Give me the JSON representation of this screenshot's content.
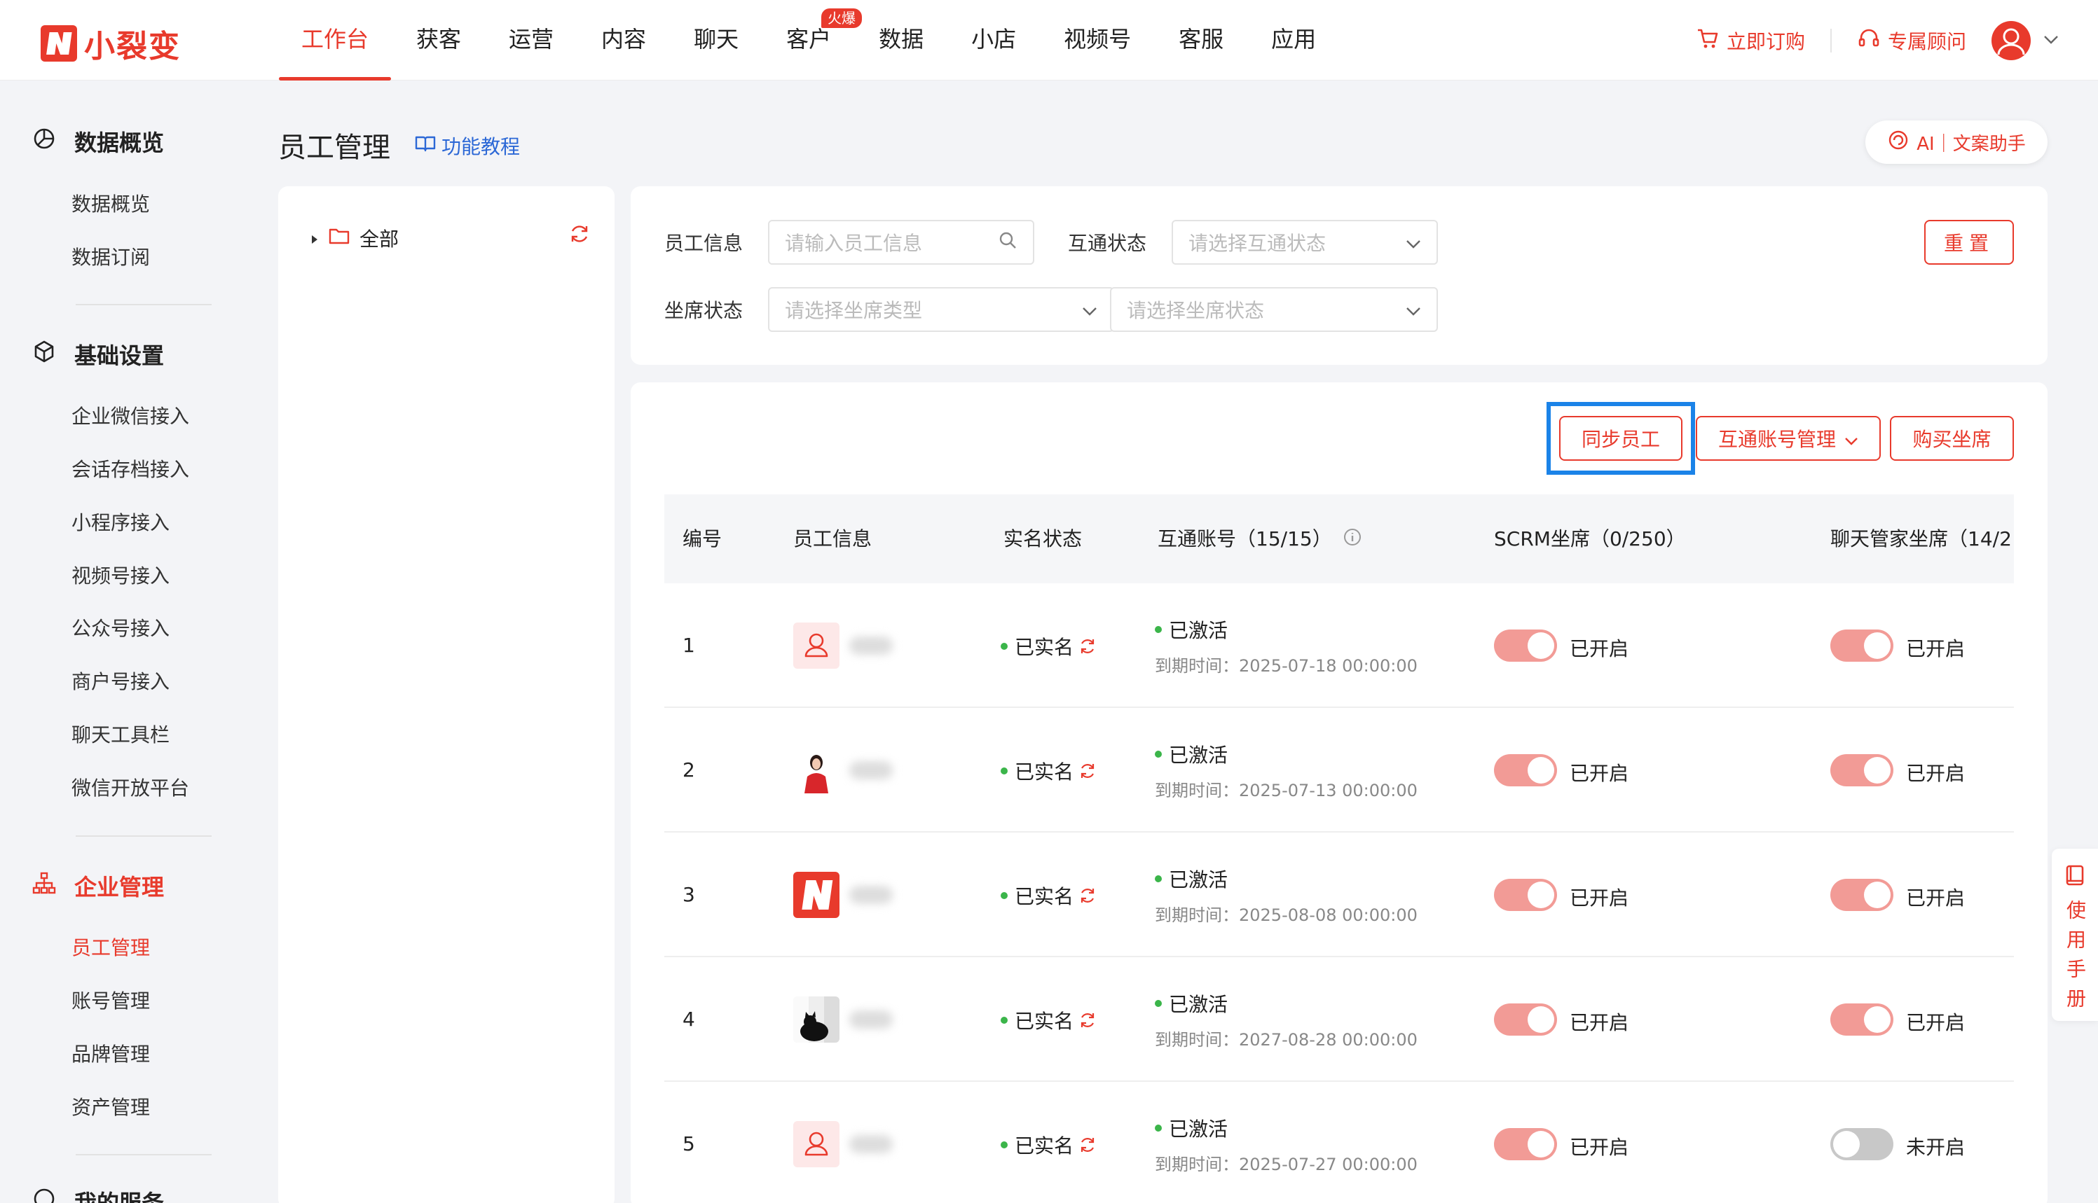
{
  "brand": {
    "name": "小裂变",
    "color": "#e83a2c"
  },
  "topnav": {
    "items": [
      "工作台",
      "获客",
      "运营",
      "内容",
      "聊天",
      "客户",
      "数据",
      "小店",
      "视频号",
      "客服",
      "应用"
    ],
    "active_index": 0,
    "hot_badge": "火爆",
    "buy_label": "立即订购",
    "advisor_label": "专属顾问"
  },
  "sidebar": {
    "groups": [
      {
        "title": "数据概览",
        "icon": "pie-chart-icon",
        "items": [
          "数据概览",
          "数据订阅"
        ]
      },
      {
        "title": "基础设置",
        "icon": "cube-icon",
        "items": [
          "企业微信接入",
          "会话存档接入",
          "小程序接入",
          "视频号接入",
          "公众号接入",
          "商户号接入",
          "聊天工具栏",
          "微信开放平台"
        ]
      },
      {
        "title": "企业管理",
        "icon": "org-chart-icon",
        "items": [
          "员工管理",
          "账号管理",
          "品牌管理",
          "资产管理"
        ]
      },
      {
        "title": "我的服务",
        "icon": "service-icon",
        "items": []
      }
    ],
    "active_item": "员工管理"
  },
  "header": {
    "title": "员工管理",
    "tutorial_label": "功能教程",
    "ai_label": "AI｜文案助手"
  },
  "tree": {
    "root_label": "全部"
  },
  "filters": {
    "employee_label": "员工信息",
    "employee_placeholder": "请输入员工信息",
    "hutong_label": "互通状态",
    "hutong_placeholder": "请选择互通状态",
    "seat_label": "坐席状态",
    "seat_type_placeholder": "请选择坐席类型",
    "seat_status_placeholder": "请选择坐席状态",
    "reset_label": "重置"
  },
  "actions": {
    "sync_label": "同步员工",
    "hutong_manage_label": "互通账号管理",
    "buy_seat_label": "购买坐席"
  },
  "table": {
    "columns": [
      "编号",
      "员工信息",
      "实名状态",
      "互通账号（15/15）",
      "SCRM坐席（0/250）",
      "聊天管家坐席（14/2"
    ],
    "rows": [
      {
        "id": "1",
        "avatar": "default-avatar",
        "realname": "已实名",
        "status": "已激活",
        "expire_label": "到期时间：",
        "expire": "2025-07-18 00:00:00",
        "scrm": "已开启",
        "scrm_on": true,
        "chat": "已开启",
        "chat_on": true
      },
      {
        "id": "2",
        "avatar": "photo-woman",
        "realname": "已实名",
        "status": "已激活",
        "expire_label": "到期时间：",
        "expire": "2025-07-13 00:00:00",
        "scrm": "已开启",
        "scrm_on": true,
        "chat": "已开启",
        "chat_on": true
      },
      {
        "id": "3",
        "avatar": "brand-logo",
        "realname": "已实名",
        "status": "已激活",
        "expire_label": "到期时间：",
        "expire": "2025-08-08 00:00:00",
        "scrm": "已开启",
        "scrm_on": true,
        "chat": "已开启",
        "chat_on": true
      },
      {
        "id": "4",
        "avatar": "photo-cat",
        "realname": "已实名",
        "status": "已激活",
        "expire_label": "到期时间：",
        "expire": "2027-08-28 00:00:00",
        "scrm": "已开启",
        "scrm_on": true,
        "chat": "已开启",
        "chat_on": true
      },
      {
        "id": "5",
        "avatar": "default-avatar",
        "realname": "已实名",
        "status": "已激活",
        "expire_label": "到期时间：",
        "expire": "2025-07-27 00:00:00",
        "scrm": "已开启",
        "scrm_on": true,
        "chat": "未开启",
        "chat_on": false
      }
    ]
  },
  "manual_tab": {
    "label": "使用手册"
  }
}
